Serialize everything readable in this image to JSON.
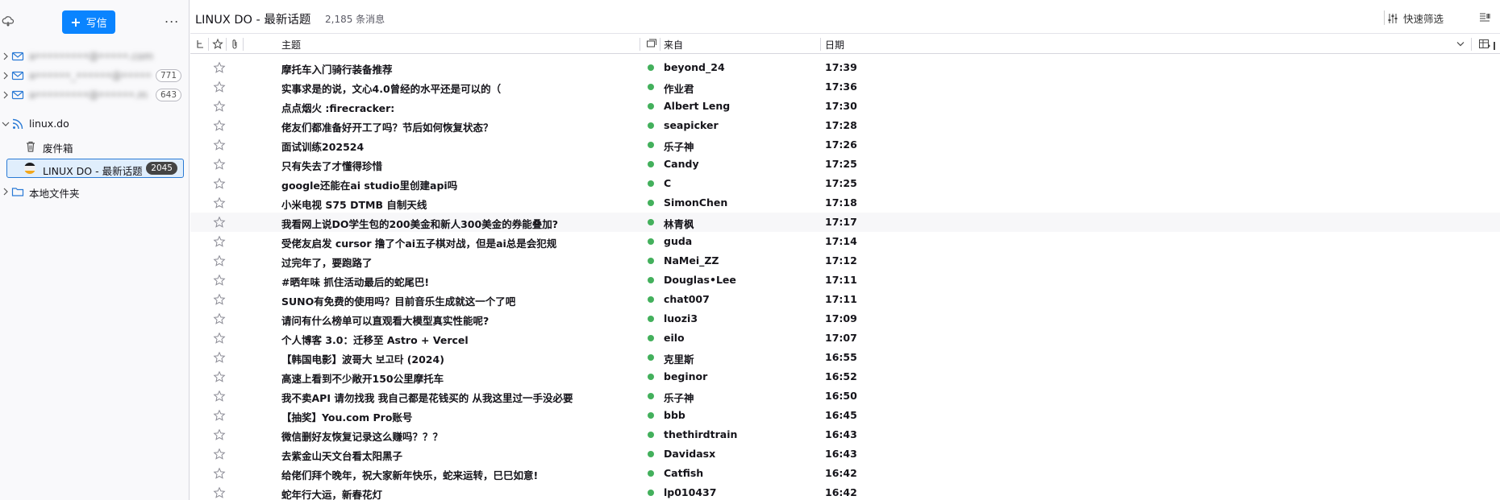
{
  "sidebar": {
    "compose_label": "写信",
    "more_label": "...",
    "accounts": [
      {
        "label": "a•••••••••@•••••.com",
        "badge": ""
      },
      {
        "label": "a••••••_••••••@•••••",
        "badge": "771"
      },
      {
        "label": "a•••••••••@••••••.m",
        "badge": "643"
      }
    ],
    "feed": {
      "label": "linux.do"
    },
    "trash": {
      "label": "废件箱"
    },
    "selected_folder": {
      "label": "LINUX DO - 最新话题",
      "badge": "2045"
    },
    "local": {
      "label": "本地文件夹"
    }
  },
  "header": {
    "title": "LINUX DO - 最新话题",
    "count": "2,185 条消息",
    "quick_filter": "快速筛选"
  },
  "columns": {
    "subject": "主题",
    "from": "来自",
    "date": "日期"
  },
  "messages": [
    {
      "subject": "摩托车入门骑行装备推荐",
      "from": "beyond_24",
      "date": "17:39"
    },
    {
      "subject": "实事求是的说，文心4.0曾经的水平还是可以的（",
      "from": "作业君",
      "date": "17:36"
    },
    {
      "subject": "点点烟火 :firecracker:",
      "from": "Albert Leng",
      "date": "17:30"
    },
    {
      "subject": "佬友们都准备好开工了吗？节后如何恢复状态？",
      "from": "seapicker",
      "date": "17:28"
    },
    {
      "subject": "面试训练202524",
      "from": "乐子神",
      "date": "17:26"
    },
    {
      "subject": "只有失去了才懂得珍惜",
      "from": "Candy",
      "date": "17:25"
    },
    {
      "subject": "google还能在ai studio里创建api吗",
      "from": "C",
      "date": "17:25"
    },
    {
      "subject": "小米电视 S75 DTMB 自制天线",
      "from": "SimonChen",
      "date": "17:18"
    },
    {
      "subject": "我看网上说DO学生包的200美金和新人300美金的券能叠加?",
      "from": "林青枫",
      "date": "17:17"
    },
    {
      "subject": "受佬友启发 cursor 撸了个ai五子棋对战，但是ai总是会犯规",
      "from": "guda",
      "date": "17:14"
    },
    {
      "subject": "过完年了，要跑路了",
      "from": "NaMei_ZZ",
      "date": "17:12"
    },
    {
      "subject": "#晒年味 抓住活动最后的蛇尾巴!",
      "from": "Douglas•Lee",
      "date": "17:11"
    },
    {
      "subject": "SUNO有免费的使用吗？目前音乐生成就这一个了吧",
      "from": "chat007",
      "date": "17:11"
    },
    {
      "subject": "请问有什么榜单可以直观看大模型真实性能呢?",
      "from": "luozi3",
      "date": "17:09"
    },
    {
      "subject": "个人博客 3.0：迁移至 Astro + Vercel",
      "from": "eilo",
      "date": "17:07"
    },
    {
      "subject": "【韩国电影】波哥大 보고타 (2024)",
      "from": "克里斯",
      "date": "16:55"
    },
    {
      "subject": "高速上看到不少敞开150公里摩托车",
      "from": "beginor",
      "date": "16:52"
    },
    {
      "subject": "我不卖API 请勿找我 我自己都是花钱买的 从我这里过一手没必要",
      "from": "乐子神",
      "date": "16:50"
    },
    {
      "subject": "【抽奖】You.com Pro账号",
      "from": "bbb",
      "date": "16:45"
    },
    {
      "subject": "微信删好友恢复记录这么赚吗？？？",
      "from": "thethirdtrain",
      "date": "16:43"
    },
    {
      "subject": "去紫金山天文台看太阳黑子",
      "from": "Davidasx",
      "date": "16:43"
    },
    {
      "subject": "给佬们拜个晚年，祝大家新年快乐，蛇来运转，巳巳如意!",
      "from": "Catfish",
      "date": "16:42"
    },
    {
      "subject": "蛇年行大运，新春花灯",
      "from": "lp010437",
      "date": "16:42"
    }
  ]
}
